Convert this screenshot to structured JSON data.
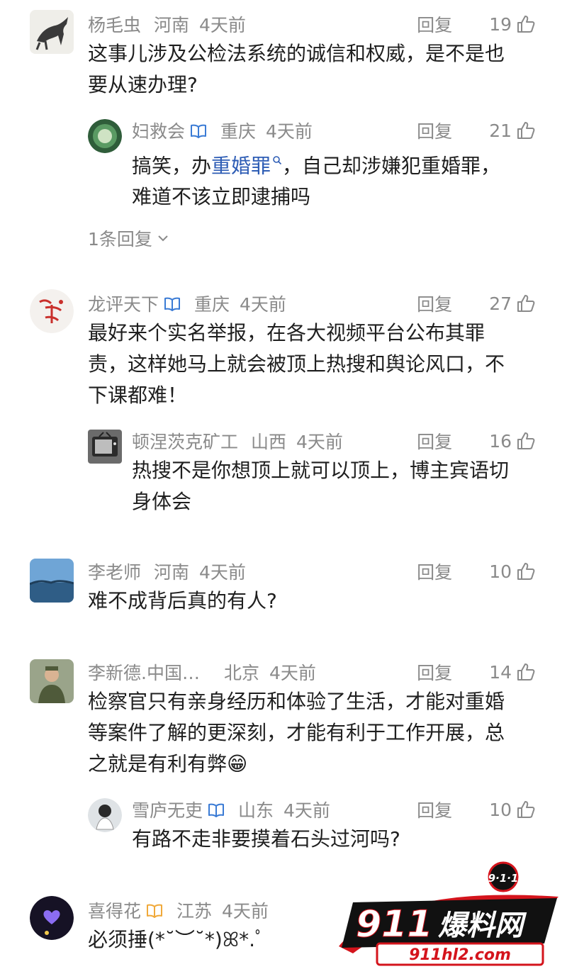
{
  "reply_label": "回复",
  "comments": [
    {
      "user": "杨毛虫",
      "region": "河南",
      "time": "4天前",
      "likes": "19",
      "text_lines": [
        "这事儿涉及公检法系统的诚信和权威，是不是也",
        "要从速办理?"
      ],
      "replies": [
        {
          "user": "妇救会",
          "region": "重庆",
          "time": "4天前",
          "likes": "21",
          "text_prefix": "搞笑，办",
          "text_link": "重婚罪",
          "text_suffix": "，自己却涉嫌犯重婚罪，",
          "text_line2": "难道不该立即逮捕吗"
        }
      ],
      "more_replies": "1条回复"
    },
    {
      "user": "龙评天下",
      "region": "重庆",
      "time": "4天前",
      "likes": "27",
      "text_lines": [
        "最好来个实名举报，在各大视频平台公布其罪",
        "责，这样她马上就会被顶上热搜和舆论风口，不",
        "下课都难！"
      ],
      "replies": [
        {
          "user": "顿涅茨克矿工",
          "region": "山西",
          "time": "4天前",
          "likes": "16",
          "text_lines": [
            "热搜不是你想顶上就可以顶上，博主宾语切",
            "身体会"
          ]
        }
      ]
    },
    {
      "user": "李老师",
      "region": "河南",
      "time": "4天前",
      "likes": "10",
      "text_lines": [
        "难不成背后真的有人?"
      ]
    },
    {
      "user": "李新德.中国…",
      "region": "北京",
      "time": "4天前",
      "likes": "14",
      "text_lines": [
        "检察官只有亲身经历和体验了生活，才能对重婚",
        "等案件了解的更深刻，才能有利于工作开展，总",
        "之就是有利有弊😁"
      ],
      "replies": [
        {
          "user": "雪庐无吏",
          "region": "山东",
          "time": "4天前",
          "likes": "10",
          "text_lines": [
            "有路不走非要摸着石头过河吗?"
          ]
        }
      ]
    },
    {
      "user": "喜得花",
      "region": "江苏",
      "time": "4天前",
      "text_lines": [
        "必须捶(*˘︶˘*)ꕤ*.ﾟ"
      ]
    }
  ],
  "watermark": {
    "badge": "9·1·1",
    "title_num": "911",
    "title_cn": "爆料网",
    "url": "911hl2.com"
  },
  "colors": {
    "meta_gray": "#8a8a8a",
    "link_blue": "#2e5db5",
    "verified_blue": "#3a7bd5",
    "verified_gold": "#f0a93a",
    "logo_red": "#d4141c"
  }
}
